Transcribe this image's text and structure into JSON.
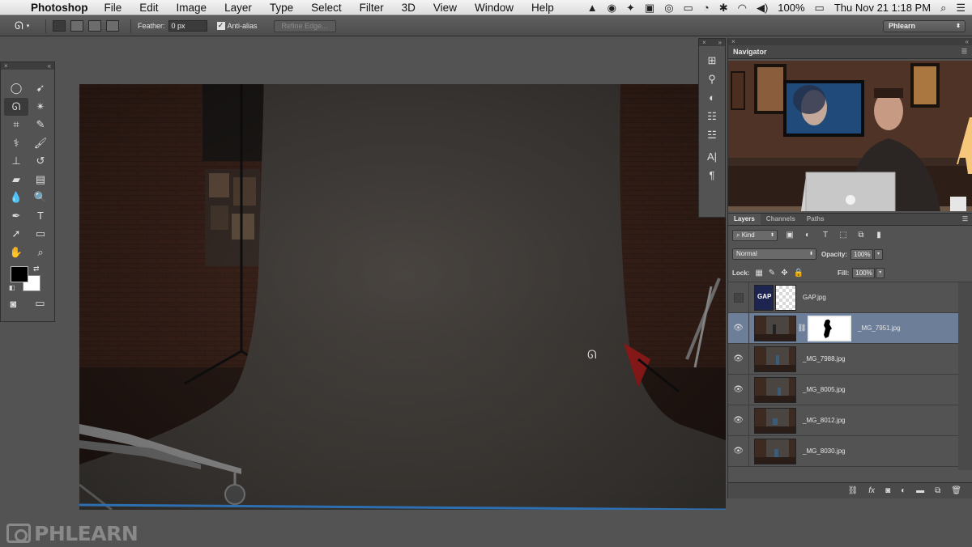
{
  "menubar": {
    "apple_glyph": "",
    "app_name": "Photoshop",
    "menus": [
      "File",
      "Edit",
      "Image",
      "Layer",
      "Type",
      "Select",
      "Filter",
      "3D",
      "View",
      "Window",
      "Help"
    ],
    "battery": "100%",
    "datetime": "Thu Nov 21  1:18 PM"
  },
  "options_bar": {
    "feather_label": "Feather:",
    "feather_value": "0 px",
    "antialias_label": "Anti-alias",
    "antialias_checked": true,
    "refine_edge_label": "Refine Edge...",
    "workspace": "Phlearn"
  },
  "navigator": {
    "title": "Navigator"
  },
  "layers_panel": {
    "tabs": [
      "Layers",
      "Channels",
      "Paths"
    ],
    "active_tab": "Layers",
    "filter_kind": "Kind",
    "blend_mode": "Normal",
    "opacity_label": "Opacity:",
    "opacity_value": "100%",
    "lock_label": "Lock:",
    "fill_label": "Fill:",
    "fill_value": "100%",
    "layers": [
      {
        "name": "GAP.jpg",
        "visible": false,
        "selected": false,
        "has_mask": false
      },
      {
        "name": "_MG_7951.jpg",
        "visible": true,
        "selected": true,
        "has_mask": true
      },
      {
        "name": "_MG_7988.jpg",
        "visible": true,
        "selected": false,
        "has_mask": false
      },
      {
        "name": "_MG_8005.jpg",
        "visible": true,
        "selected": false,
        "has_mask": false
      },
      {
        "name": "_MG_8012.jpg",
        "visible": true,
        "selected": false,
        "has_mask": false
      },
      {
        "name": "_MG_8030.jpg",
        "visible": true,
        "selected": false,
        "has_mask": false
      }
    ]
  },
  "watermark": {
    "text": "PHLEARN"
  },
  "colors": {
    "selected_layer": "#6d7e99",
    "panel_bg": "#535353",
    "foreground": "#000000",
    "background": "#ffffff"
  }
}
